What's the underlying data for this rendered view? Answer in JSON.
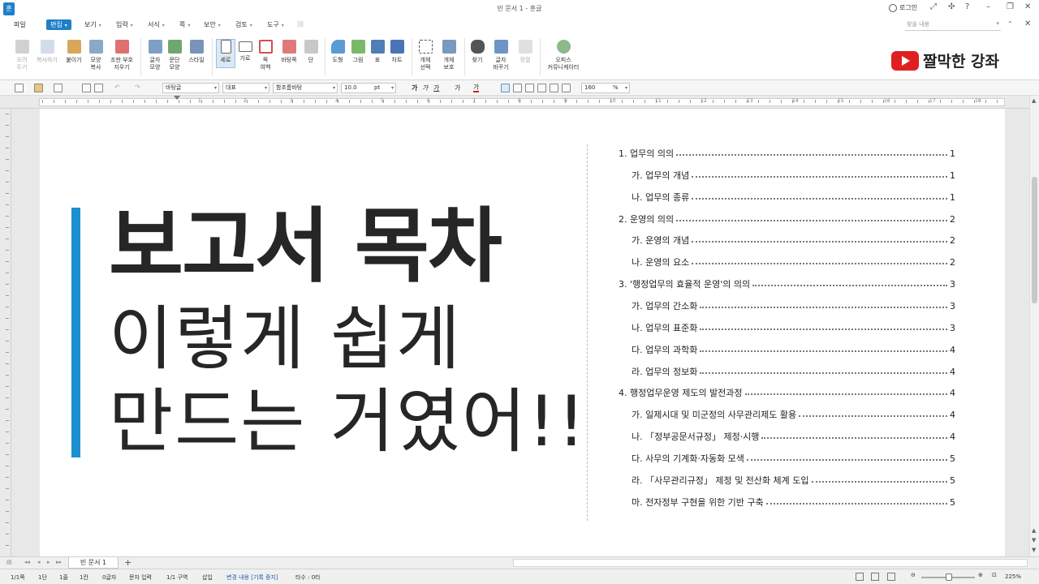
{
  "window": {
    "title": "빈 문서 1 - 훈글",
    "login": "로그인",
    "app_logo": "훈"
  },
  "menu": {
    "items": [
      "파일",
      "편집",
      "보기",
      "입력",
      "서식",
      "쪽",
      "보안",
      "검토",
      "도구"
    ],
    "search_placeholder": "찾을 내용"
  },
  "ribbon": {
    "buttons": [
      {
        "label": "오려\n두기",
        "icon": "scissors-icon",
        "disabled": true
      },
      {
        "label": "복사하기",
        "icon": "copy-icon",
        "disabled": true
      },
      {
        "label": "붙이기",
        "icon": "paste-icon"
      },
      {
        "label": "모양\n복사",
        "icon": "format-painter-icon"
      },
      {
        "label": "조판 부호\n지우기",
        "icon": "clear-code-icon"
      },
      {
        "label": "글자\n모양",
        "icon": "char-shape-icon"
      },
      {
        "label": "문단\n모양",
        "icon": "para-shape-icon"
      },
      {
        "label": "스타일",
        "icon": "style-icon"
      },
      {
        "label": "세로",
        "icon": "portrait-icon",
        "active": true
      },
      {
        "label": "가로",
        "icon": "landscape-icon"
      },
      {
        "label": "쪽\n여백",
        "icon": "margin-icon"
      },
      {
        "label": "바탕쪽",
        "icon": "master-page-icon"
      },
      {
        "label": "단",
        "icon": "columns-icon"
      },
      {
        "label": "도형",
        "icon": "shape-icon"
      },
      {
        "label": "그림",
        "icon": "picture-icon"
      },
      {
        "label": "표",
        "icon": "table-icon"
      },
      {
        "label": "차트",
        "icon": "chart-icon"
      },
      {
        "label": "개체\n선택",
        "icon": "select-object-icon"
      },
      {
        "label": "개체\n보호",
        "icon": "protect-object-icon"
      },
      {
        "label": "찾기",
        "icon": "binoculars-icon"
      },
      {
        "label": "글자\n바꾸기",
        "icon": "replace-icon"
      },
      {
        "label": "정렬",
        "icon": "sort-icon",
        "disabled": true
      },
      {
        "label": "오피스\n커뮤니케이터",
        "icon": "communicator-icon"
      }
    ]
  },
  "badge": {
    "text": "짤막한 강좌",
    "icon": "youtube-icon"
  },
  "formatbar": {
    "style": "바탕글",
    "lang": "대표",
    "font": "함초롬바탕",
    "size": "10.0",
    "size_unit": "pt",
    "char_buttons": [
      "가",
      "가",
      "가",
      "가",
      "가"
    ],
    "zoom": "160",
    "zoom_unit": "%"
  },
  "ruler": {
    "labels": [
      "1",
      "2",
      "3",
      "4",
      "5",
      "6",
      "7",
      "8",
      "9",
      "10",
      "11",
      "12",
      "13",
      "14",
      "15",
      "16",
      "17",
      "18"
    ]
  },
  "document": {
    "headline_bold": "보고서 목차",
    "headline_line2": "이렇게 쉽게",
    "headline_line3": "만드는 거였어!!",
    "accent_color": "#1c8fd0",
    "toc": [
      {
        "label": "1. 업무의 의의",
        "page": "1",
        "level": 1
      },
      {
        "label": "가. 업무의 개념",
        "page": "1",
        "level": 2
      },
      {
        "label": "나. 업무의 종류",
        "page": "1",
        "level": 2
      },
      {
        "label": "2. 운영의 의의",
        "page": "2",
        "level": 1
      },
      {
        "label": "가. 운영의 개념",
        "page": "2",
        "level": 2
      },
      {
        "label": "나. 운영의 요소",
        "page": "2",
        "level": 2
      },
      {
        "label": "3. '행정업무의 효율적 운영'의 의의",
        "page": "3",
        "level": 1
      },
      {
        "label": "가. 업무의 간소화",
        "page": "3",
        "level": 2
      },
      {
        "label": "나. 업무의 표준화",
        "page": "3",
        "level": 2
      },
      {
        "label": "다. 업무의 과학화",
        "page": "4",
        "level": 2
      },
      {
        "label": "라. 업무의 정보화",
        "page": "4",
        "level": 2
      },
      {
        "label": "4. 행정업무운영 제도의 발전과정",
        "page": "4",
        "level": 1
      },
      {
        "label": "가. 일제시대 및 미군정의 사무관리제도 활용",
        "page": "4",
        "level": 2
      },
      {
        "label": "나. 「정부공문서규정」 제정·시행",
        "page": "4",
        "level": 2
      },
      {
        "label": "다. 사무의 기계화·자동화 모색",
        "page": "5",
        "level": 2
      },
      {
        "label": "라. 「사무관리규정」 제정 및 전산화 체계 도입",
        "page": "5",
        "level": 2
      },
      {
        "label": "마. 전자정부 구현을 위한 기반 구축",
        "page": "5",
        "level": 2
      }
    ]
  },
  "tabs": {
    "doc_tab": "빈 문서 1",
    "add": "+"
  },
  "status": {
    "page": "1/1쪽",
    "section": "1단",
    "line": "1줄",
    "column": "1칸",
    "chars": "0글자",
    "input_mode": "문자 입력",
    "area": "1/1 구역",
    "insert": "삽입",
    "track": "변경 내용 [기록 중지]",
    "typing": "타수 : 0타",
    "zoom": "225%"
  }
}
